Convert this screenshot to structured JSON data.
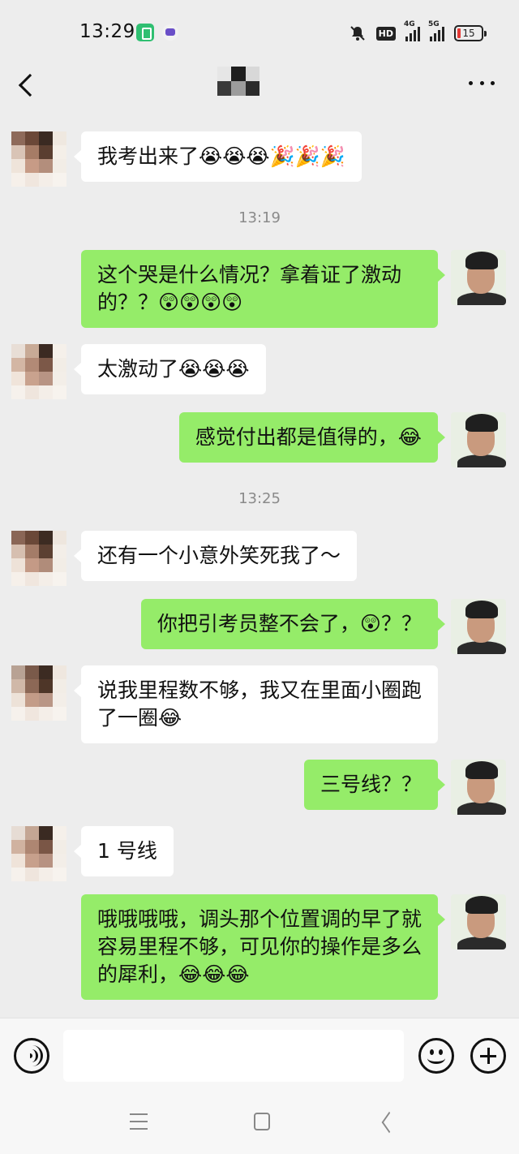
{
  "status_bar": {
    "time": "13:29",
    "network_1": "4G",
    "network_2": "5G",
    "hd_label": "HD",
    "battery": "15",
    "icons": [
      "app-green-icon",
      "app-purple-icon",
      "mute-bell-icon",
      "signal-icon",
      "battery-icon"
    ]
  },
  "header": {
    "back_icon": "chevron-left-icon",
    "more_icon": "more-dots-icon"
  },
  "messages": [
    {
      "side": "in",
      "text": "我考出来了😭😭😭🎉🎉🎉"
    },
    {
      "timestamp": "13:19"
    },
    {
      "side": "out",
      "text": "这个哭是什么情况？拿着证了激动的？？😲😲😲😲"
    },
    {
      "side": "in",
      "text": "太激动了😭😭😭"
    },
    {
      "side": "out",
      "text": "感觉付出都是值得的，😂"
    },
    {
      "timestamp": "13:25"
    },
    {
      "side": "in",
      "text": "还有一个小意外笑死我了～"
    },
    {
      "side": "out",
      "text": "你把引考员整不会了，😲？？"
    },
    {
      "side": "in",
      "text": "说我里程数不够，我又在里面小圈跑了一圈😂"
    },
    {
      "side": "out",
      "text": "三号线？？"
    },
    {
      "side": "in",
      "text": "1 号线"
    },
    {
      "side": "out",
      "text": "哦哦哦哦，调头那个位置调的早了就容易里程不够，可见你的操作是多么的犀利，😂😂😂"
    }
  ],
  "input_bar": {
    "placeholder": "",
    "voice_icon": "voice-icon",
    "emoji_icon": "emoji-icon",
    "plus_icon": "plus-icon"
  },
  "colors": {
    "background": "#ededed",
    "incoming_bubble": "#ffffff",
    "outgoing_bubble": "#95ec69",
    "timestamp_text": "#8a8a8a"
  }
}
